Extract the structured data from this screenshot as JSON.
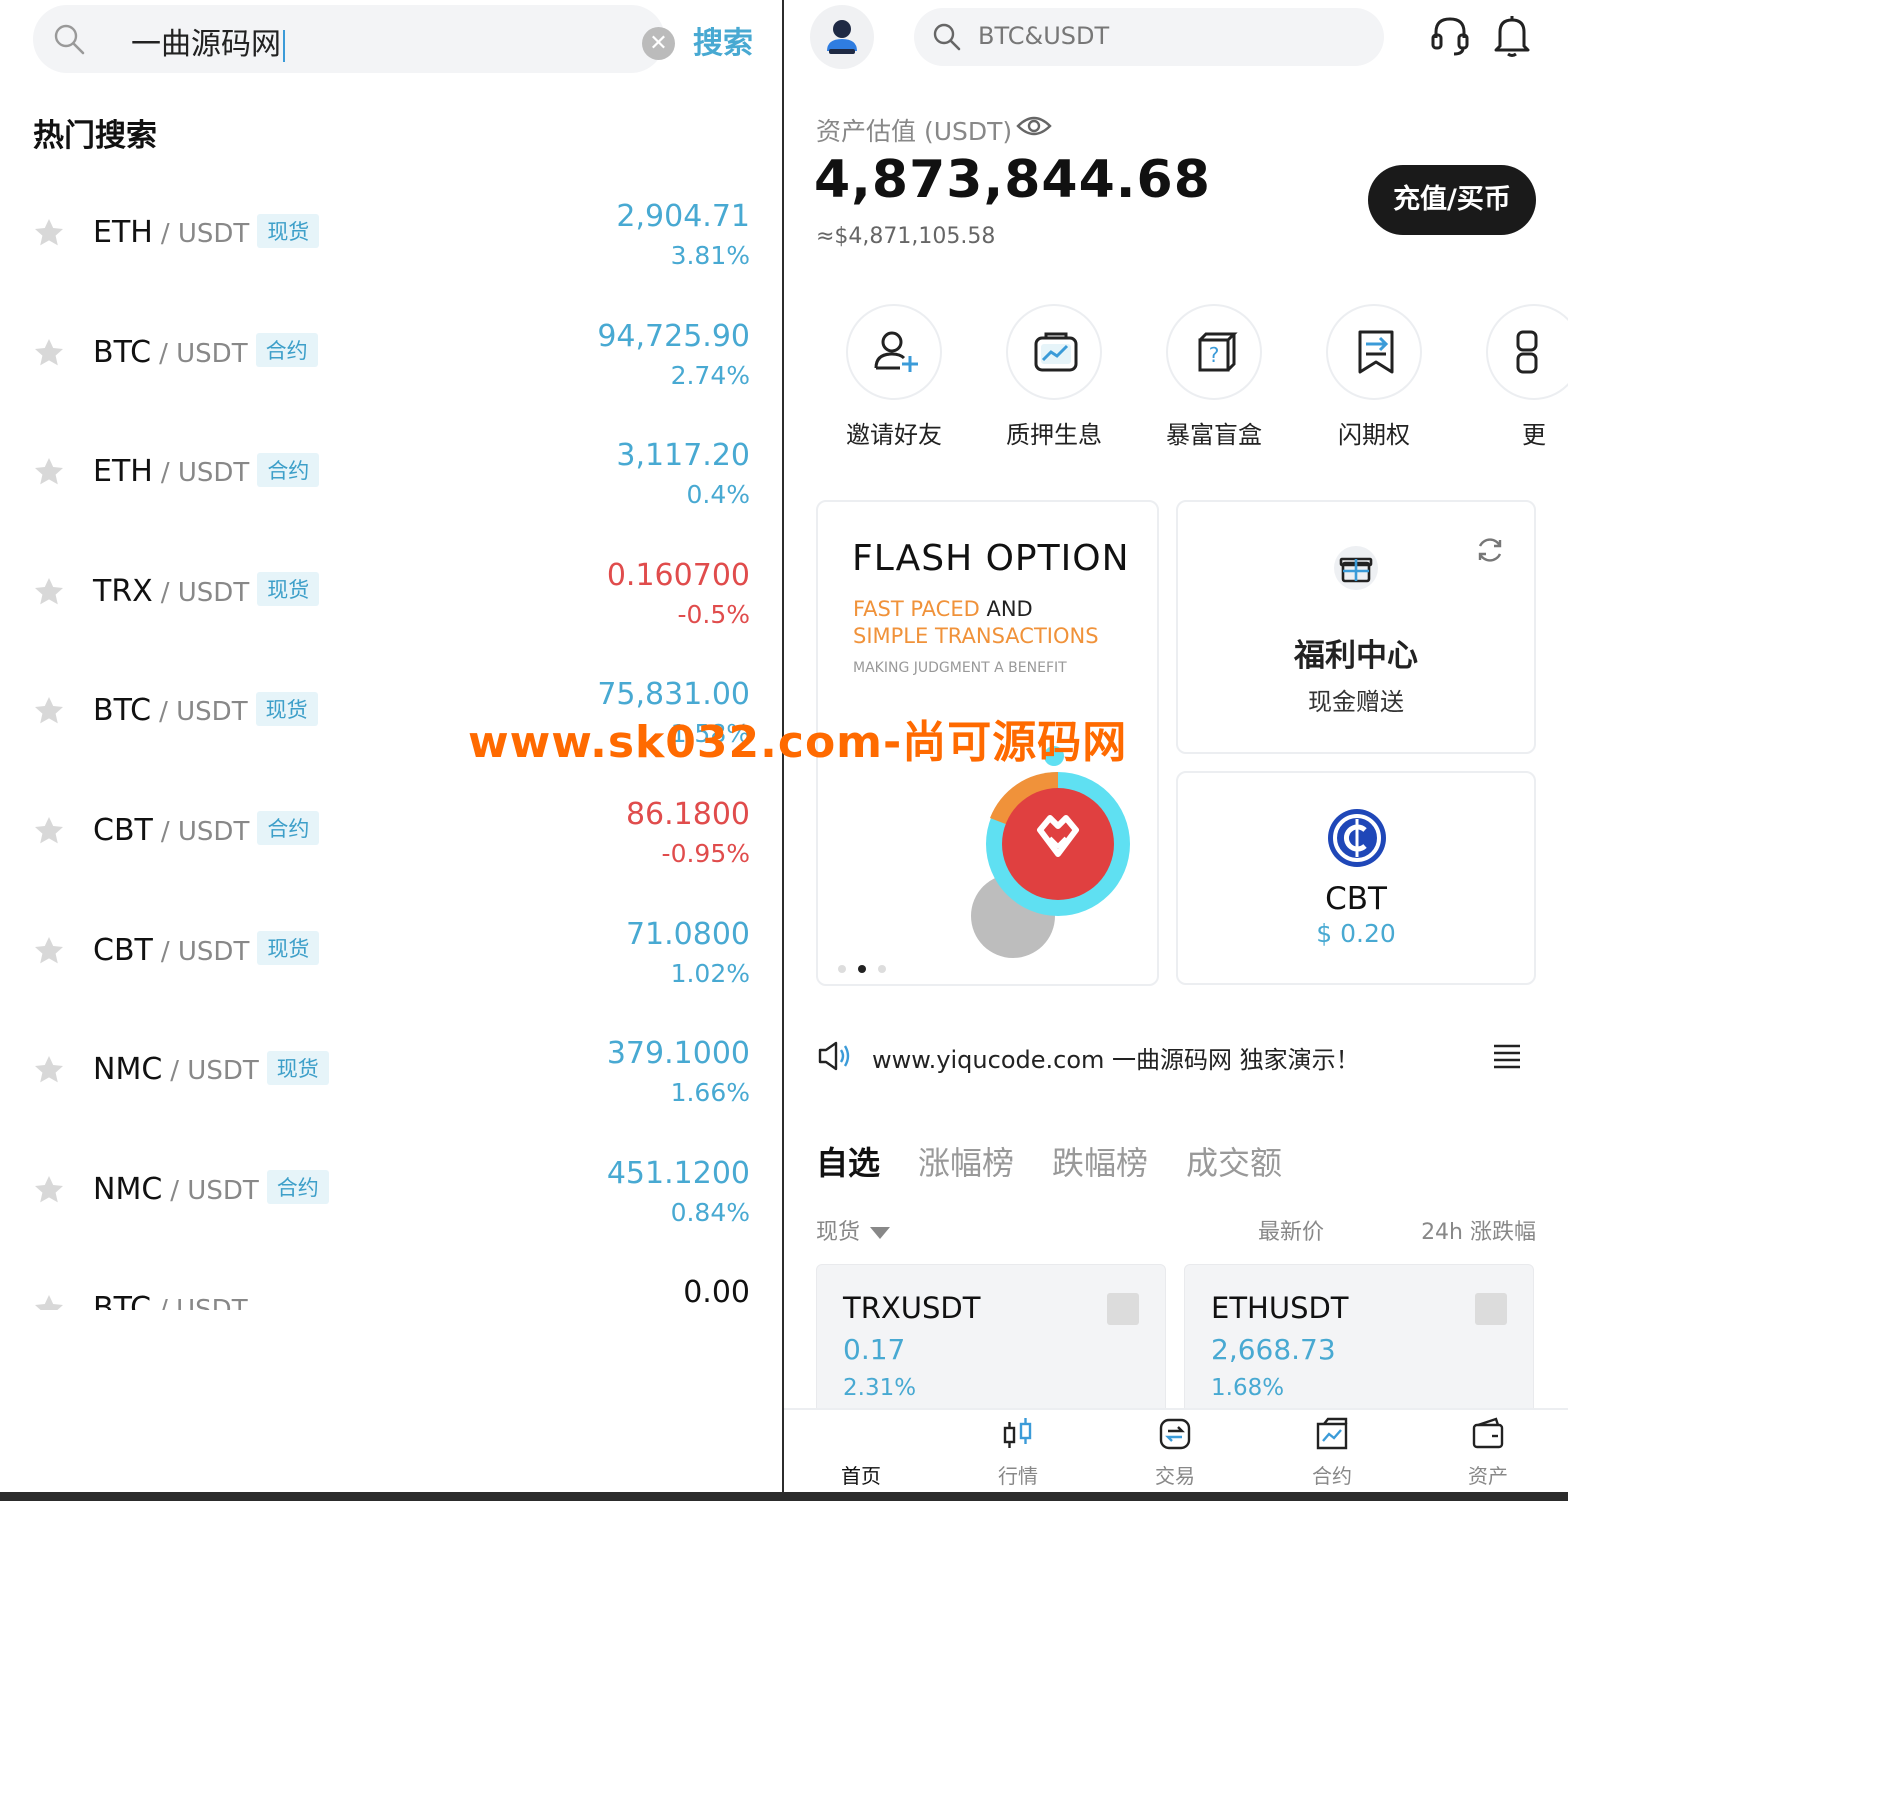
{
  "left_panel": {
    "search": {
      "value": "一曲源码网",
      "clear_symbol": "✕",
      "button": "搜索"
    },
    "hot_title": "热门搜索",
    "items": [
      {
        "base": "ETH",
        "quote": "/ USDT",
        "badge": "现货",
        "price": "2,904.71",
        "pct": "3.81%",
        "dir": "up"
      },
      {
        "base": "BTC",
        "quote": "/ USDT",
        "badge": "合约",
        "price": "94,725.90",
        "pct": "2.74%",
        "dir": "up"
      },
      {
        "base": "ETH",
        "quote": "/ USDT",
        "badge": "合约",
        "price": "3,117.20",
        "pct": "0.4%",
        "dir": "up"
      },
      {
        "base": "TRX",
        "quote": "/ USDT",
        "badge": "现货",
        "price": "0.160700",
        "pct": "-0.5%",
        "dir": "down"
      },
      {
        "base": "BTC",
        "quote": "/ USDT",
        "badge": "现货",
        "price": "75,831.00",
        "pct": "1.58%",
        "dir": "up"
      },
      {
        "base": "CBT",
        "quote": "/ USDT",
        "badge": "合约",
        "price": "86.1800",
        "pct": "-0.95%",
        "dir": "down"
      },
      {
        "base": "CBT",
        "quote": "/ USDT",
        "badge": "现货",
        "price": "71.0800",
        "pct": "1.02%",
        "dir": "up"
      },
      {
        "base": "NMC",
        "quote": "/ USDT",
        "badge": "现货",
        "price": "379.1000",
        "pct": "1.66%",
        "dir": "up"
      },
      {
        "base": "NMC",
        "quote": "/ USDT",
        "badge": "合约",
        "price": "451.1200",
        "pct": "0.84%",
        "dir": "up"
      },
      {
        "base": "BTC",
        "quote": "/ USDT",
        "badge": "",
        "price": "0.00",
        "pct": "",
        "dir": "zero"
      }
    ]
  },
  "right_panel": {
    "search_placeholder": "BTC&USDT",
    "asset": {
      "label": "资产估值 (USDT)",
      "value": "4,873,844.68",
      "usd": "≈$4,871,105.58",
      "deposit_button": "充值/买币"
    },
    "shortcuts": [
      "邀请好友",
      "质押生息",
      "暴富盲盒",
      "闪期权",
      "更"
    ],
    "flash_card": {
      "title": "FLASH OPTION",
      "line1_a": "FAST PACED",
      "line1_b": "AND",
      "line2": "SIMPLE TRANSACTIONS",
      "line3": "MAKING JUDGMENT A BENEFIT"
    },
    "welfare_card": {
      "title": "福利中心",
      "subtitle": "现金赠送"
    },
    "coin_card": {
      "symbol": "CBT",
      "price": "$ 0.20"
    },
    "notice": "www.yiqucode.com 一曲源码网 独家演示！",
    "tabs": [
      "自选",
      "涨幅榜",
      "跌幅榜",
      "成交额"
    ],
    "list_header": {
      "market": "现货",
      "latest_price": "最新价",
      "change_24h": "24h 涨跌幅"
    },
    "market_cards": [
      {
        "symbol": "TRXUSDT",
        "price": "0.17",
        "pct": "2.31%"
      },
      {
        "symbol": "ETHUSDT",
        "price": "2,668.73",
        "pct": "1.68%"
      }
    ],
    "bottom_nav": [
      "首页",
      "行情",
      "交易",
      "合约",
      "资产"
    ]
  },
  "watermark": "www.sk032.com-尚可源码网",
  "colors": {
    "accent": "#48a9d2",
    "down": "#e04c4c",
    "dark": "#1a1a1a",
    "watermark": "#ff6a00"
  }
}
